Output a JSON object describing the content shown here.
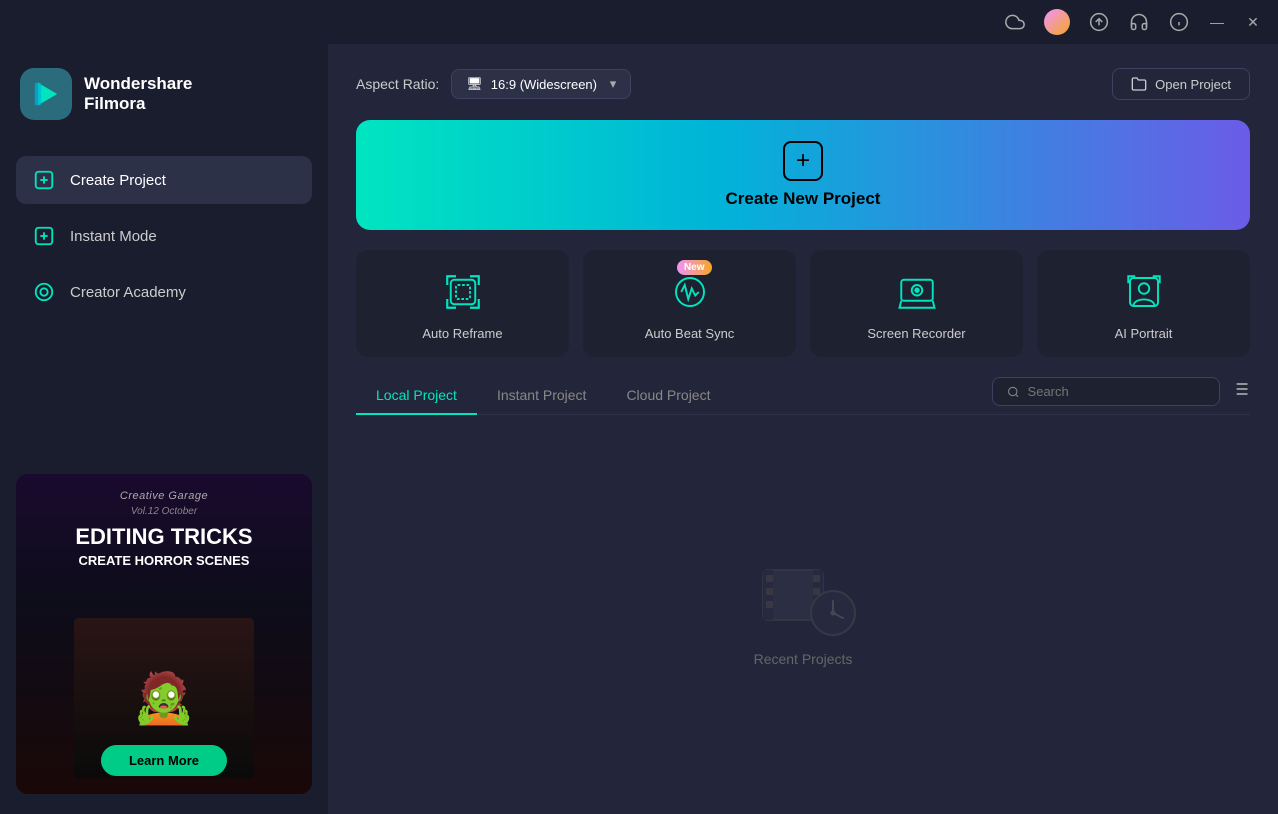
{
  "titlebar": {
    "icons": [
      "cloud",
      "avatar",
      "upload",
      "headphones",
      "info"
    ],
    "win_min": "—",
    "win_close": "✕"
  },
  "sidebar": {
    "logo": {
      "title_line1": "Wondershare",
      "title_line2": "Filmora"
    },
    "nav_items": [
      {
        "id": "create-project",
        "label": "Create Project",
        "active": true
      },
      {
        "id": "instant-mode",
        "label": "Instant Mode",
        "active": false
      },
      {
        "id": "creator-academy",
        "label": "Creator Academy",
        "active": false
      }
    ],
    "promo": {
      "title_small": "Creative Garage",
      "title_sub": "Vol.12 October",
      "main_text": "EDITING TRICKS",
      "sub_text": "CREATE HORROR SCENES",
      "button_label": "Learn More"
    }
  },
  "content": {
    "topbar": {
      "aspect_label": "Aspect Ratio:",
      "aspect_icon": "🖥",
      "aspect_value": "16:9 (Widescreen)",
      "open_project_label": "Open Project"
    },
    "create_banner": {
      "label": "Create New Project"
    },
    "features": [
      {
        "id": "auto-reframe",
        "label": "Auto Reframe",
        "new": false
      },
      {
        "id": "auto-beat-sync",
        "label": "Auto Beat Sync",
        "new": true
      },
      {
        "id": "screen-recorder",
        "label": "Screen Recorder",
        "new": false
      },
      {
        "id": "ai-portrait",
        "label": "AI Portrait",
        "new": false
      }
    ],
    "projects": {
      "tabs": [
        {
          "id": "local",
          "label": "Local Project",
          "active": true
        },
        {
          "id": "instant",
          "label": "Instant Project",
          "active": false
        },
        {
          "id": "cloud",
          "label": "Cloud Project",
          "active": false
        }
      ],
      "search_placeholder": "Search",
      "empty_label": "Recent Projects"
    }
  }
}
